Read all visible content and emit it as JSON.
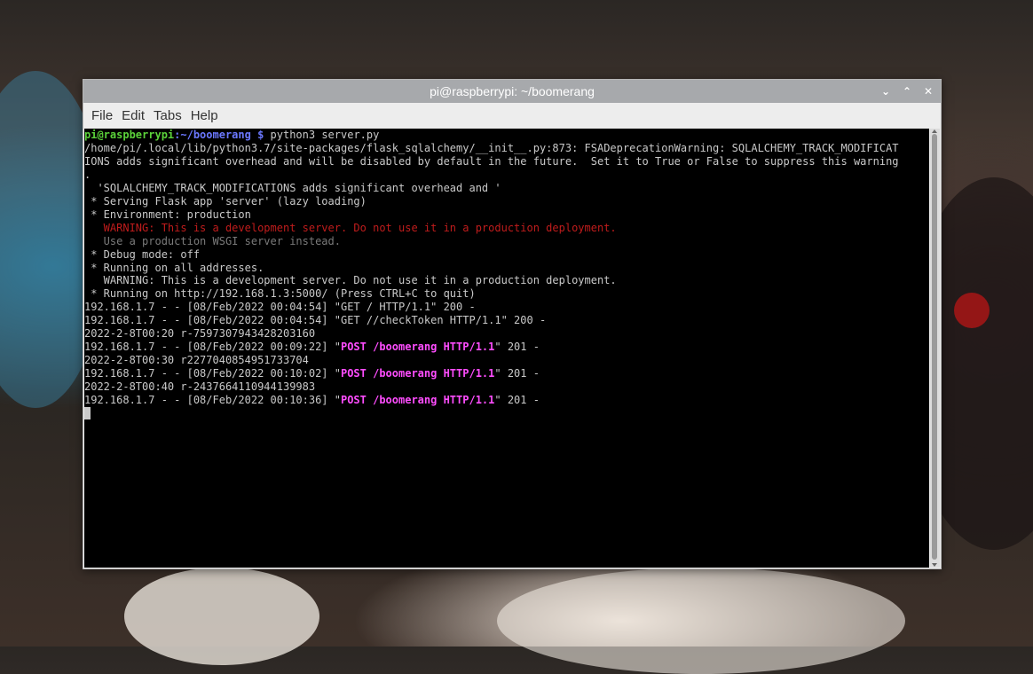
{
  "window": {
    "title": "pi@raspberrypi: ~/boomerang",
    "controls": [
      "chevron-down",
      "chevron-up",
      "close"
    ]
  },
  "menu": [
    "File",
    "Edit",
    "Tabs",
    "Help"
  ],
  "terminal": {
    "prompt_user": "pi@raspberrypi",
    "prompt_path": ":~/boomerang $",
    "command": " python3 server.py",
    "lines": [
      "/home/pi/.local/lib/python3.7/site-packages/flask_sqlalchemy/__init__.py:873: FSADeprecationWarning: SQLALCHEMY_TRACK_MODIFICAT",
      "IONS adds significant overhead and will be disabled by default in the future.  Set it to True or False to suppress this warning",
      ".",
      "  'SQLALCHEMY_TRACK_MODIFICATIONS adds significant overhead and '",
      " * Serving Flask app 'server' (lazy loading)",
      " * Environment: production",
      "   WARNING: This is a development server. Do not use it in a production deployment.",
      "   Use a production WSGI server instead.",
      " * Debug mode: off",
      " * Running on all addresses.",
      "   WARNING: This is a development server. Do not use it in a production deployment.",
      " * Running on http://192.168.1.3:5000/ (Press CTRL+C to quit)",
      "192.168.1.7 - - [08/Feb/2022 00:04:54] \"GET / HTTP/1.1\" 200 -",
      "192.168.1.7 - - [08/Feb/2022 00:04:54] \"GET //checkToken HTTP/1.1\" 200 -",
      "2022-2-8T00:20 r-7597307943428203160",
      "2022-2-8T00:30 r2277040854951733704",
      "2022-2-8T00:40 r-2437664110944139983"
    ],
    "post_lines": [
      {
        "prefix": "192.168.1.7 - - [08/Feb/2022 00:09:22] \"",
        "request": "POST /boomerang HTTP/1.1",
        "suffix": "\" 201 -"
      },
      {
        "prefix": "192.168.1.7 - - [08/Feb/2022 00:10:02] \"",
        "request": "POST /boomerang HTTP/1.1",
        "suffix": "\" 201 -"
      },
      {
        "prefix": "192.168.1.7 - - [08/Feb/2022 00:10:36] \"",
        "request": "POST /boomerang HTTP/1.1",
        "suffix": "\" 201 -"
      }
    ]
  },
  "colors": {
    "prompt_user": "#5bd23a",
    "prompt_path": "#6b78ff",
    "warning": "#c01c1c",
    "post_request": "#ff4dff"
  }
}
